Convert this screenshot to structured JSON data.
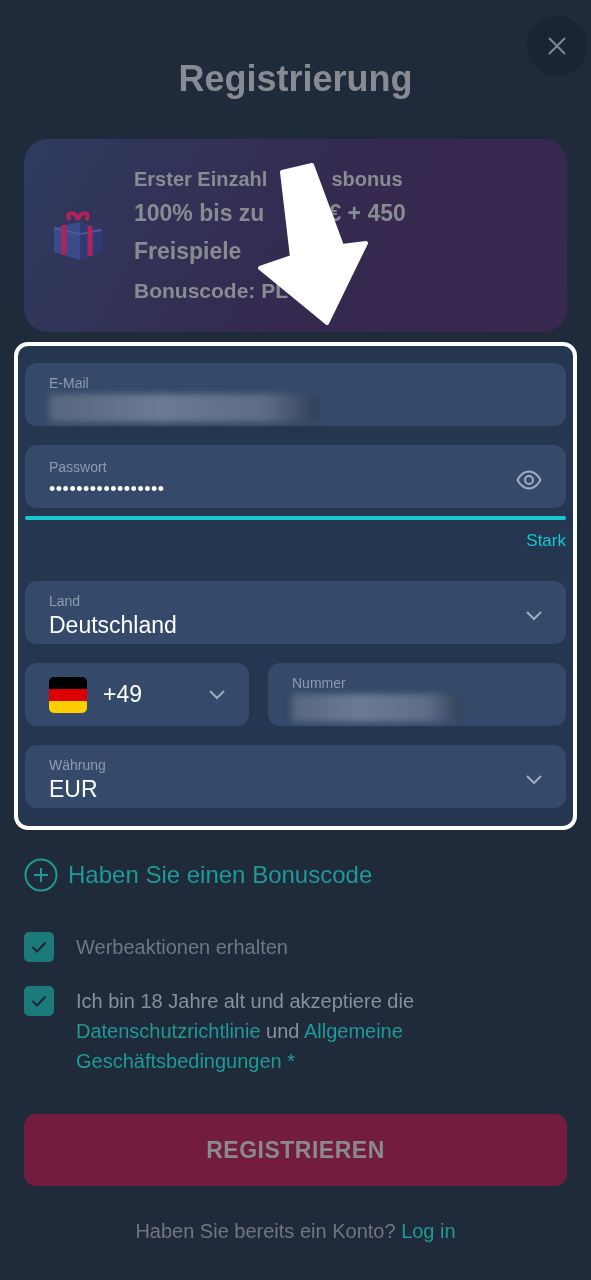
{
  "title": "Registrierung",
  "bonus_card": {
    "lines": [
      {
        "kind": "caption",
        "parts": [
          "Erster Einzahl",
          "sbonus"
        ]
      },
      {
        "kind": "headline",
        "parts": [
          "100% bis zu",
          "€ + 450"
        ]
      },
      {
        "kind": "headline",
        "parts": [
          "Freispiele"
        ]
      },
      {
        "kind": "code",
        "parts": [
          "Bonuscode:  PL"
        ]
      }
    ]
  },
  "form": {
    "email": {
      "label": "E-Mail"
    },
    "password": {
      "label": "Passwort",
      "value": "•••••••••••••••••",
      "strength": {
        "level": 1,
        "label": "Stark"
      }
    },
    "country": {
      "label": "Land",
      "value": "Deutschland"
    },
    "phone": {
      "code": "+49",
      "number_label": "Nummer"
    },
    "currency": {
      "label": "Währung",
      "value": "EUR"
    }
  },
  "bonus_code_link": "Haben Sie einen Bonuscode",
  "checkboxes": [
    {
      "checked": true,
      "parts": [
        {
          "kind": "text",
          "text": "Werbeaktionen erhalten"
        }
      ]
    },
    {
      "checked": true,
      "parts": [
        {
          "kind": "text",
          "text": "Ich bin 18 Jahre alt und akzeptiere die "
        },
        {
          "kind": "link",
          "text": "Datenschutzrichtlinie"
        },
        {
          "kind": "text",
          "text": " und "
        },
        {
          "kind": "link",
          "text": "Allgemeine"
        },
        {
          "kind": "link",
          "text": "Geschäftsbedingungen"
        },
        {
          "kind": "mark",
          "text": " *"
        }
      ]
    }
  ],
  "submit_button": "REGISTRIEREN",
  "footer": {
    "text": "Haben Sie bereits ein Konto?",
    "link": "Log in"
  }
}
